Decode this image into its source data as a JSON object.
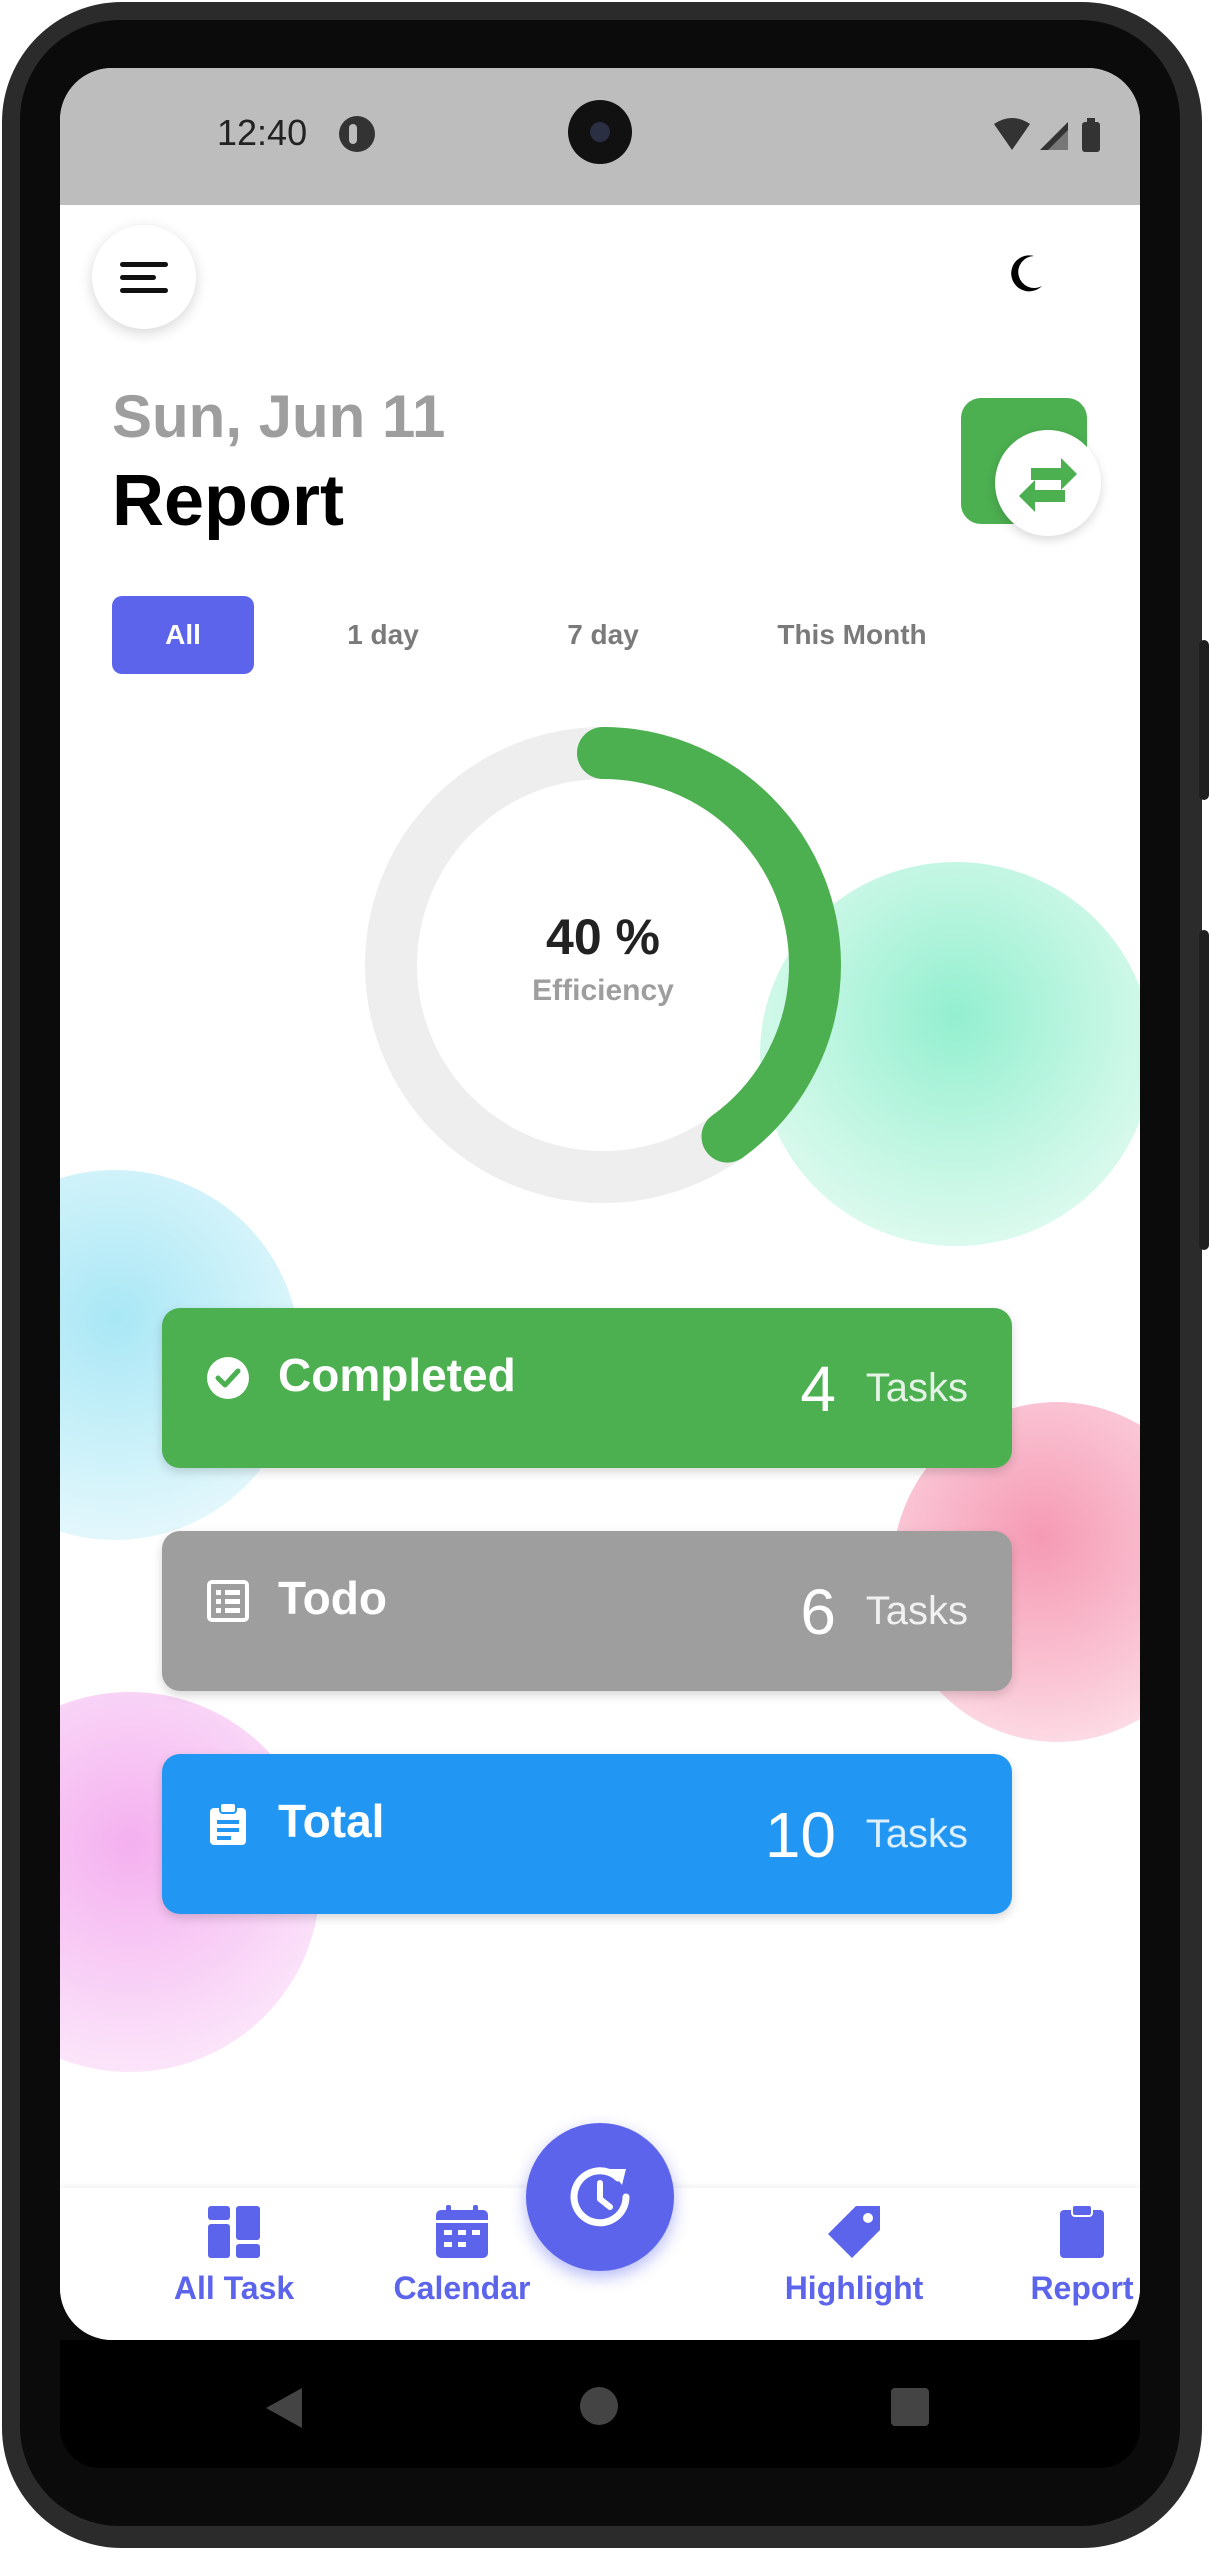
{
  "status_bar": {
    "time": "12:40"
  },
  "header": {
    "date": "Sun, Jun 11",
    "title": "Report"
  },
  "filters": [
    {
      "label": "All",
      "active": true
    },
    {
      "label": "1 day",
      "active": false
    },
    {
      "label": "7 day",
      "active": false
    },
    {
      "label": "This Month",
      "active": false
    }
  ],
  "efficiency": {
    "value_text": "40 %",
    "label": "Efficiency",
    "fraction": 0.4
  },
  "stats": [
    {
      "label": "Completed",
      "count": "4",
      "unit": "Tasks",
      "icon": "check-circle-icon",
      "color": "#4caf50"
    },
    {
      "label": "Todo",
      "count": "6",
      "unit": "Tasks",
      "icon": "list-icon",
      "color": "#9e9e9e"
    },
    {
      "label": "Total",
      "count": "10",
      "unit": "Tasks",
      "icon": "clipboard-icon",
      "color": "#2196f3"
    }
  ],
  "bottom_nav": [
    {
      "label": "All Task",
      "icon": "dashboard-icon"
    },
    {
      "label": "Calendar",
      "icon": "calendar-icon"
    },
    {
      "label": "Highlight",
      "icon": "tag-icon"
    },
    {
      "label": "Report",
      "icon": "clipboard-icon"
    }
  ],
  "colors": {
    "accent": "#5c64ec",
    "green": "#4caf50",
    "grey": "#9e9e9e",
    "blue": "#2196f3"
  }
}
